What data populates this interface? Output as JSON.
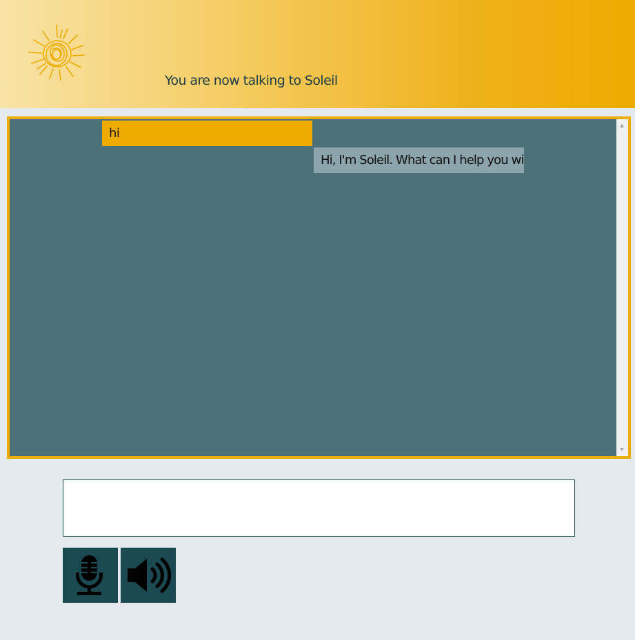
{
  "header": {
    "title": "You are now talking to Soleil",
    "logo_icon": "sun-logo-icon"
  },
  "chat": {
    "messages": [
      {
        "sender": "user",
        "text": "hi"
      },
      {
        "sender": "bot",
        "text": "Hi, I'm Soleil. What can I help you with?"
      }
    ]
  },
  "input": {
    "value": "",
    "placeholder": ""
  },
  "controls": {
    "mic_icon": "microphone-icon",
    "speaker_icon": "speaker-volume-icon"
  },
  "colors": {
    "accent": "#eeab00",
    "chat_background": "#4d7179",
    "bot_bubble": "#8ca4ab",
    "button": "#1a4951",
    "page_background": "#e4eaed"
  }
}
